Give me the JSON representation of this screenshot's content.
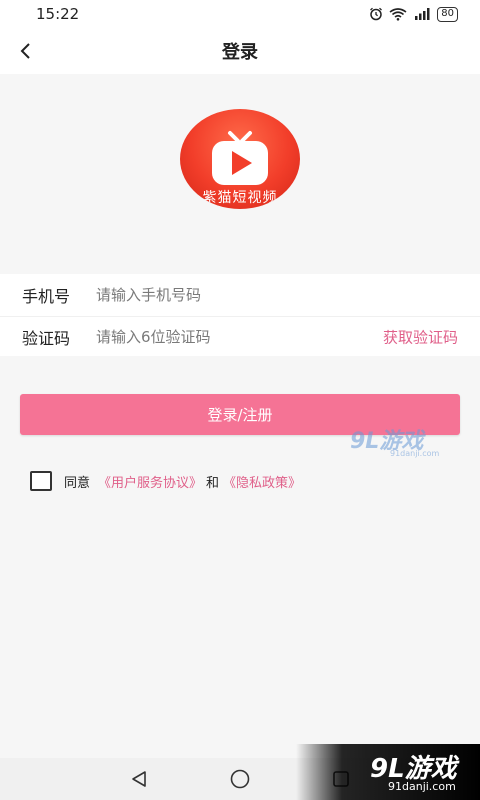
{
  "status_bar": {
    "time": "15:22",
    "battery": "80"
  },
  "header": {
    "title": "登录"
  },
  "logo": {
    "text": "紫猫短视频"
  },
  "form": {
    "phone": {
      "label": "手机号",
      "placeholder": "请输入手机号码",
      "value": ""
    },
    "code": {
      "label": "验证码",
      "placeholder": "请输入6位验证码",
      "value": "",
      "get_code": "获取验证码"
    }
  },
  "login_button": {
    "label": "登录/注册"
  },
  "agreement": {
    "checked": false,
    "prefix": "同意",
    "service_link": "《用户服务协议》",
    "and": "和",
    "privacy_link": "《隐私政策》"
  },
  "watermark": {
    "main": "9L游戏",
    "sub": "91danji.com"
  },
  "colors": {
    "accent": "#f57395",
    "link": "#e0608a",
    "logo_red": "#f23e2a"
  }
}
